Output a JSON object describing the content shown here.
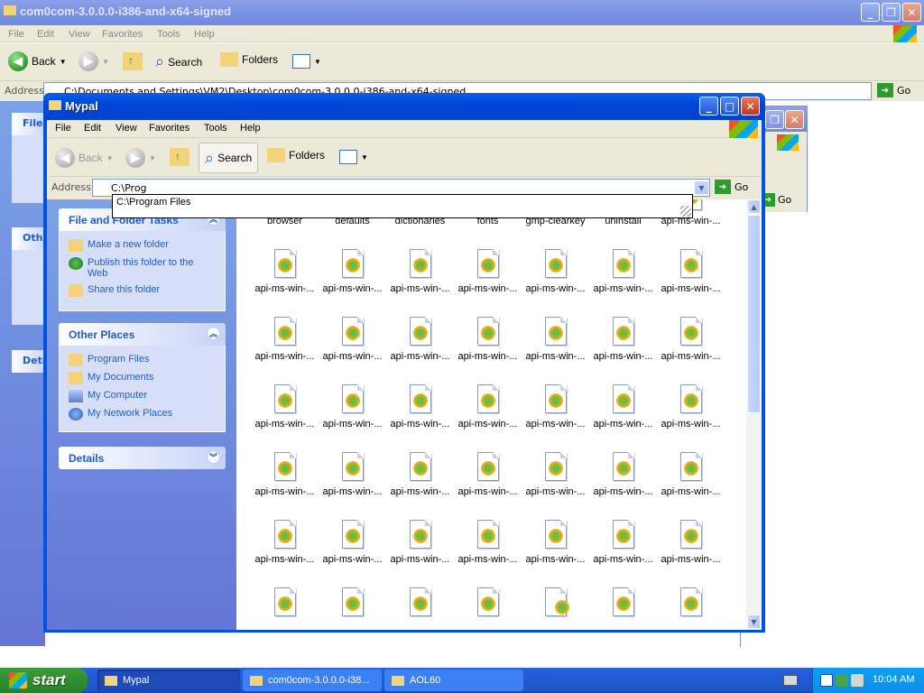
{
  "bg_window": {
    "title": "com0com-3.0.0.0-i386-and-x64-signed",
    "menu": [
      "File",
      "Edit",
      "View",
      "Favorites",
      "Tools",
      "Help"
    ],
    "toolbar": {
      "back": "Back",
      "search": "Search",
      "folders": "Folders"
    },
    "address_label": "Address",
    "address_value": "C:\\Documents and Settings\\VM2\\Desktop\\com0com-3.0.0.0-i386-and-x64-signed",
    "go": "Go",
    "side_partial": [
      "File",
      "Othe",
      "Deta"
    ]
  },
  "aol_window": {
    "go": "Go"
  },
  "main_window": {
    "title": "Mypal",
    "menu": [
      "File",
      "Edit",
      "View",
      "Favorites",
      "Tools",
      "Help"
    ],
    "toolbar": {
      "back": "Back",
      "search": "Search",
      "folders": "Folders"
    },
    "address_label": "Address",
    "address_value": "C:\\Prog",
    "go": "Go",
    "autocomplete": [
      "C:\\Program Files"
    ],
    "tasks_panel": {
      "title": "File and Folder Tasks",
      "items": [
        "Make a new folder",
        "Publish this folder to the Web",
        "Share this folder"
      ]
    },
    "places_panel": {
      "title": "Other Places",
      "items": [
        "Program Files",
        "My Documents",
        "My Computer",
        "My Network Places"
      ]
    },
    "details_panel": {
      "title": "Details"
    },
    "folders": [
      "browser",
      "defaults",
      "dictionaries",
      "fonts",
      "gmp-clearkey",
      "uninstall",
      "api-ms-win-..."
    ],
    "file_label": "api-ms-win-..."
  },
  "taskbar": {
    "start": "start",
    "tasks": [
      "Mypal",
      "com0com-3.0.0.0-i38...",
      "AOL60"
    ],
    "clock": "10:04 AM"
  }
}
